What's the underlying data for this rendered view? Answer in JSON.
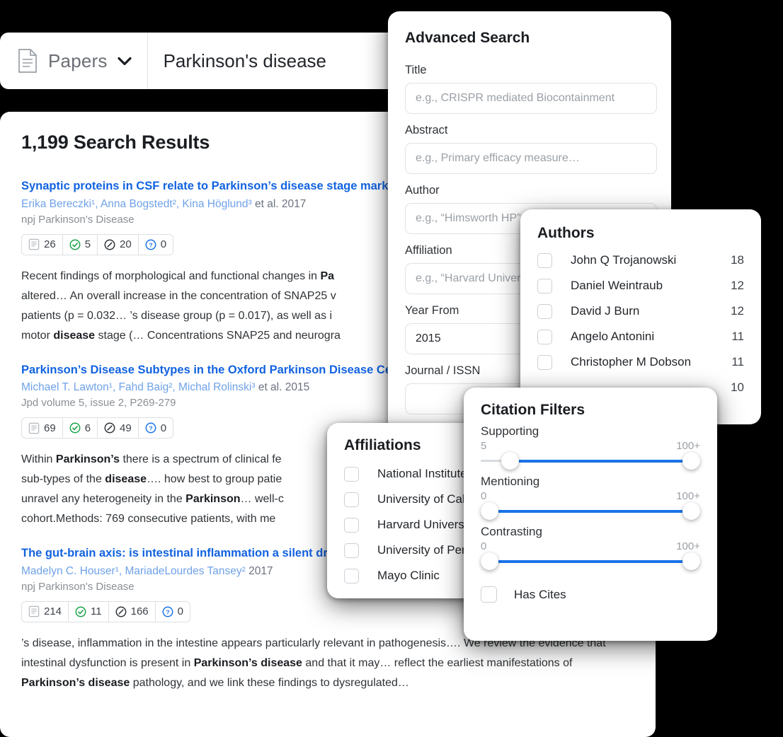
{
  "search_bar": {
    "type_label": "Papers",
    "type_icon": "document-icon",
    "chevron_icon": "chevron-down-icon",
    "query": "Parkinson's disease"
  },
  "results_panel": {
    "title": "1,199 Search Results",
    "results": [
      {
        "title": "Synaptic proteins in CSF relate to Parkinson’s disease stage markers",
        "authors": "Erika Bereczki¹, Anna Bogstedt², Kina Höglund³",
        "etal_year": " et al. 2017",
        "journal": "npj Parkinson's Disease",
        "stats": [
          {
            "icon": "document-icon",
            "value": "26"
          },
          {
            "icon": "check-circle-icon",
            "value": "5"
          },
          {
            "icon": "slash-circle-icon",
            "value": "20"
          },
          {
            "icon": "question-circle-icon",
            "value": "0"
          }
        ],
        "abstract_lines": [
          "Recent findings of morphological and functional changes in <b>Pa</b>",
          "altered… An overall increase in the concentration of SNAP25 v",
          "patients (p = 0.032… ’s disease group (p = 0.017), as well as i",
          "motor <b>disease</b> stage (… Concentrations SNAP25 and neurogra"
        ]
      },
      {
        "title": "Parkinson’s Disease Subtypes in the Oxford Parkinson Disease Centre",
        "authors": "Michael T. Lawton¹, Fahd Baig², Michal Rolinski³",
        "etal_year": " et al. 2015",
        "journal": "Jpd volume 5, issue 2, P269-279",
        "stats": [
          {
            "icon": "document-icon",
            "value": "69"
          },
          {
            "icon": "check-circle-icon",
            "value": "6"
          },
          {
            "icon": "slash-circle-icon",
            "value": "49"
          },
          {
            "icon": "question-circle-icon",
            "value": "0"
          }
        ],
        "abstract_lines": [
          "Within <b>Parkinson’s</b> there is a spectrum of clinical fe",
          "sub-types of the <b>disease</b>…. how best to group patie",
          "unravel any heterogeneity in the <b>Parkinson</b>… well-c",
          "cohort.Methods: 769 consecutive patients, with me"
        ]
      },
      {
        "title": "The gut-brain axis: is intestinal inflammation a silent driv",
        "authors": "Madelyn C. Houser¹, MariadeLourdes Tansey²",
        "etal_year": " 2017",
        "journal": "npj Parkinson's Disease",
        "stats": [
          {
            "icon": "document-icon",
            "value": "214"
          },
          {
            "icon": "check-circle-icon",
            "value": "11"
          },
          {
            "icon": "slash-circle-icon",
            "value": "166"
          },
          {
            "icon": "question-circle-icon",
            "value": "0"
          }
        ],
        "abstract_lines": [
          "’s disease, inflammation in the intestine appears particularly relevant in pathogenesis…. We review the evidence that intestinal dysfunction is present in <b>Parkinson’s disease</b> and that it may… reflect the earliest manifestations of <b>Parkinson’s disease</b> pathology, and we link these findings to dysregulated…"
        ]
      }
    ]
  },
  "advanced_search": {
    "heading": "Advanced Search",
    "fields": [
      {
        "label": "Title",
        "placeholder": "e.g., CRISPR mediated Biocontainment",
        "value": ""
      },
      {
        "label": "Abstract",
        "placeholder": "e.g., Primary efficacy measure…",
        "value": ""
      },
      {
        "label": "Author",
        "placeholder": "e.g., “Himsworth HP”",
        "value": ""
      },
      {
        "label": "Affiliation",
        "placeholder": "e.g., “Harvard University”",
        "value": ""
      },
      {
        "label": "Year From",
        "placeholder": "",
        "value": "2015"
      },
      {
        "label": "Journal / ISSN",
        "placeholder": "",
        "value": ""
      }
    ]
  },
  "authors_panel": {
    "heading": "Authors",
    "items": [
      {
        "name": "John Q Trojanowski",
        "count": "18",
        "checked": false
      },
      {
        "name": "Daniel Weintraub",
        "count": "12",
        "checked": false
      },
      {
        "name": "David J Burn",
        "count": "12",
        "checked": false
      },
      {
        "name": "Angelo Antonini",
        "count": "11",
        "checked": false
      },
      {
        "name": "Christopher M Dobson",
        "count": "11",
        "checked": false
      },
      {
        "name": "",
        "count": "10",
        "checked": false
      }
    ]
  },
  "affiliations_panel": {
    "heading": "Affiliations",
    "items": [
      {
        "name": "National Institutes of Health",
        "checked": false
      },
      {
        "name": "University of California",
        "checked": false
      },
      {
        "name": "Harvard University",
        "checked": false
      },
      {
        "name": "University of Pennsylvania",
        "checked": false
      },
      {
        "name": "Mayo Clinic",
        "checked": false
      }
    ]
  },
  "citation_filters": {
    "heading": "Citation Filters",
    "sliders": [
      {
        "name": "Supporting",
        "min_label": "5",
        "max_label": "100+",
        "min_pct": 10,
        "max_pct": 100
      },
      {
        "name": "Mentioning",
        "min_label": "0",
        "max_label": "100+",
        "min_pct": 0,
        "max_pct": 100
      },
      {
        "name": "Contrasting",
        "min_label": "0",
        "max_label": "100+",
        "min_pct": 0,
        "max_pct": 100
      }
    ],
    "has_cites_label": "Has Cites",
    "has_cites_checked": false
  },
  "colors": {
    "accent_blue": "#1a73e8",
    "link_blue": "#1263e0",
    "author_blue": "#6fa2e8",
    "green": "#1aa34a",
    "question_blue": "#1a73e8",
    "background": "#000000"
  }
}
